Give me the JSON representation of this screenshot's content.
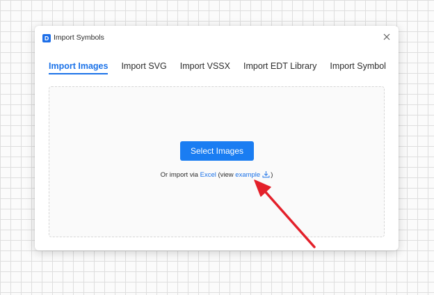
{
  "dialog": {
    "title": "Import Symbols",
    "icon": "app-logo-icon",
    "close_icon": "close-icon"
  },
  "tabs": [
    {
      "label": "Import Images",
      "active": true
    },
    {
      "label": "Import SVG",
      "active": false
    },
    {
      "label": "Import VSSX",
      "active": false
    },
    {
      "label": "Import EDT Library",
      "active": false
    },
    {
      "label": "Import Symbol",
      "active": false
    }
  ],
  "dropzone": {
    "button_label": "Select Images",
    "prefix": "Or import via",
    "excel_link": "Excel",
    "view_open": "(view",
    "example_link": "example",
    "download_icon": "download-icon",
    "view_close": ")"
  },
  "annotation": {
    "icon": "red-arrow-icon",
    "color": "#e3202a"
  },
  "colors": {
    "accent": "#1b72e8",
    "button": "#1a7df2"
  }
}
